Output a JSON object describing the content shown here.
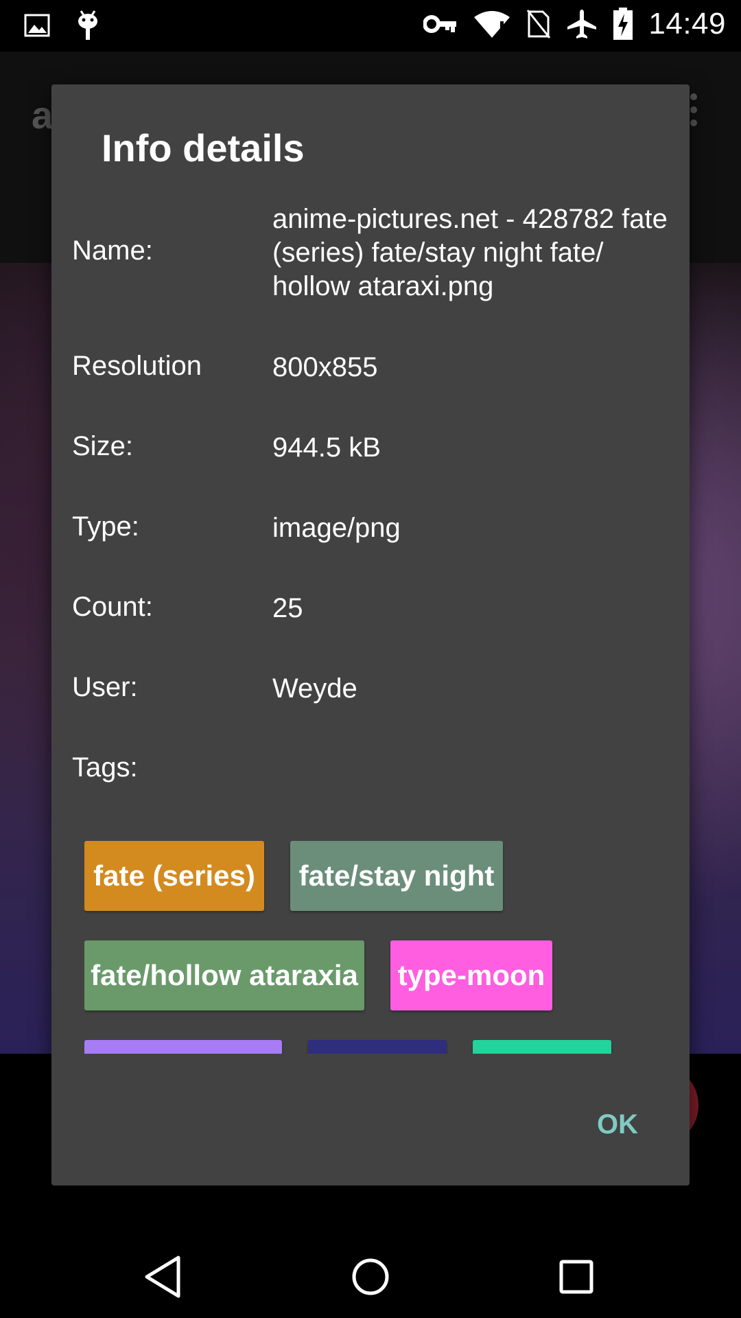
{
  "status_bar": {
    "time": "14:49",
    "left_icons": [
      "gallery-icon",
      "android-debug-icon"
    ],
    "right_icons": [
      "vpn-key-icon",
      "wifi-alert-icon",
      "no-sim-icon",
      "airplane-icon",
      "battery-charging-icon"
    ]
  },
  "background_app": {
    "title_initial": "a"
  },
  "dialog": {
    "title": "Info details",
    "rows": [
      {
        "label": "Name:",
        "value": "anime-pictures.net - 428782 fate (series) fate/stay night fate/ hollow ataraxi.png"
      },
      {
        "label": "Resolution",
        "value": "800x855"
      },
      {
        "label": "Size:",
        "value": "944.5 kB"
      },
      {
        "label": "Type:",
        "value": "image/png"
      },
      {
        "label": "Count:",
        "value": "25"
      },
      {
        "label": "User:",
        "value": "Weyde"
      }
    ],
    "tags_label": "Tags:",
    "tags": [
      {
        "label": "fate (series)",
        "color": "#d38a1f"
      },
      {
        "label": "fate/stay night",
        "color": "#6b8e7a"
      },
      {
        "label": "fate/hollow ataraxia",
        "color": "#6a9a6a"
      },
      {
        "label": "type-moon",
        "color": "#ff5ee0"
      },
      {
        "label": "",
        "color": "#a77cf5"
      },
      {
        "label": "",
        "color": "#2f2d7e"
      },
      {
        "label": "",
        "color": "#22d39b"
      }
    ],
    "ok_label": "OK",
    "accent_color": "#80cbc4",
    "background_color": "#424242"
  },
  "nav_bar": {
    "buttons": [
      "back-icon",
      "home-icon",
      "recents-icon"
    ]
  }
}
